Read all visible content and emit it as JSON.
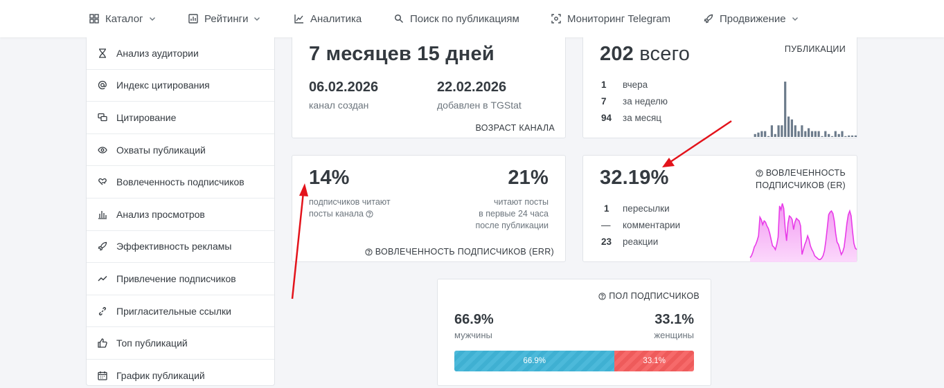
{
  "nav": {
    "items": [
      {
        "label": "Каталог",
        "icon": "grid-icon",
        "dropdown": true
      },
      {
        "label": "Рейтинги",
        "icon": "bar-chart-icon",
        "dropdown": true
      },
      {
        "label": "Аналитика",
        "icon": "line-chart-icon",
        "dropdown": false
      },
      {
        "label": "Поиск по публикациям",
        "icon": "search-icon",
        "dropdown": false
      },
      {
        "label": "Мониторинг Telegram",
        "icon": "monitor-icon",
        "dropdown": false
      },
      {
        "label": "Продвижение",
        "icon": "rocket-icon",
        "dropdown": true
      }
    ]
  },
  "sidebar": {
    "items": [
      {
        "label": "Анализ аудитории",
        "icon": "hourglass-icon"
      },
      {
        "label": "Индекс цитирования",
        "icon": "at-icon"
      },
      {
        "label": "Цитирование",
        "icon": "quote-icon"
      },
      {
        "label": "Охваты публикаций",
        "icon": "eye-icon"
      },
      {
        "label": "Вовлеченность подписчиков",
        "icon": "heart-hand-icon"
      },
      {
        "label": "Анализ просмотров",
        "icon": "bars-icon"
      },
      {
        "label": "Эффективность рекламы",
        "icon": "rocket-icon"
      },
      {
        "label": "Привлечение подписчиков",
        "icon": "trend-icon"
      },
      {
        "label": "Пригласительные ссылки",
        "icon": "link-icon"
      },
      {
        "label": "Топ публикаций",
        "icon": "thumbs-up-icon"
      },
      {
        "label": "График публикаций",
        "icon": "calendar-icon"
      }
    ]
  },
  "age": {
    "value": "7 месяцев 15 дней",
    "created_date": "06.02.2026",
    "created_label": "канал создан",
    "added_date": "22.02.2026",
    "added_label": "добавлен в TGStat",
    "title": "возраст канала"
  },
  "posts": {
    "total_num": "202",
    "total_word": "всего",
    "title": "публикации",
    "rows": [
      {
        "num": "1",
        "label": "вчера"
      },
      {
        "num": "7",
        "label": "за неделю"
      },
      {
        "num": "94",
        "label": "за месяц"
      }
    ],
    "bars": [
      2,
      3,
      4,
      4,
      0,
      8,
      2,
      8,
      8,
      38,
      14,
      12,
      8,
      4,
      8,
      4,
      6,
      4,
      4,
      4,
      0,
      4,
      2,
      0,
      4,
      2,
      4,
      0,
      1,
      1,
      1
    ]
  },
  "err": {
    "value1": "14%",
    "label1_line1": "подписчиков читают",
    "label1_line2": "посты канала",
    "value2": "21%",
    "label2_line1": "читают посты",
    "label2_line2": "в первые 24 часа",
    "label2_line3": "после публикации",
    "title": "вовлеченность подписчиков (ERR)"
  },
  "er": {
    "value": "32.19%",
    "title_line1": "вовлеченность",
    "title_line2": "подписчиков (ER)",
    "rows": [
      {
        "num": "1",
        "label": "пересылки"
      },
      {
        "num": "—",
        "label": "комментарии"
      },
      {
        "num": "23",
        "label": "реакции"
      }
    ],
    "series": [
      5,
      8,
      14,
      22,
      26,
      32,
      40,
      70,
      66,
      58,
      64,
      62,
      56,
      52,
      44,
      34,
      24,
      22,
      18,
      26,
      38,
      88,
      82,
      92,
      84,
      52,
      32,
      60,
      72,
      70,
      66,
      50,
      62,
      68,
      66,
      64,
      56,
      10,
      18,
      26,
      32,
      40,
      34,
      24,
      18,
      14,
      8,
      6,
      4,
      2,
      2,
      4,
      8,
      16,
      32,
      52,
      74,
      78,
      80,
      76,
      64,
      44,
      30,
      26,
      18,
      10,
      14,
      22,
      40,
      60,
      74,
      80,
      72,
      48,
      28,
      20,
      18
    ]
  },
  "gender": {
    "title": "пол подписчиков",
    "male_value": "66.9%",
    "male_label": "мужчины",
    "female_value": "33.1%",
    "female_label": "женщины",
    "male_bar": "66.9%",
    "female_bar": "33.1%",
    "male_fraction": 0.669
  },
  "colors": {
    "accent_magenta": "#e83be8",
    "arrow_red": "#e3131b",
    "bar_gray": "#6c7b8b",
    "male_blue": "#4cb9da",
    "female_red": "#f66a6a"
  }
}
